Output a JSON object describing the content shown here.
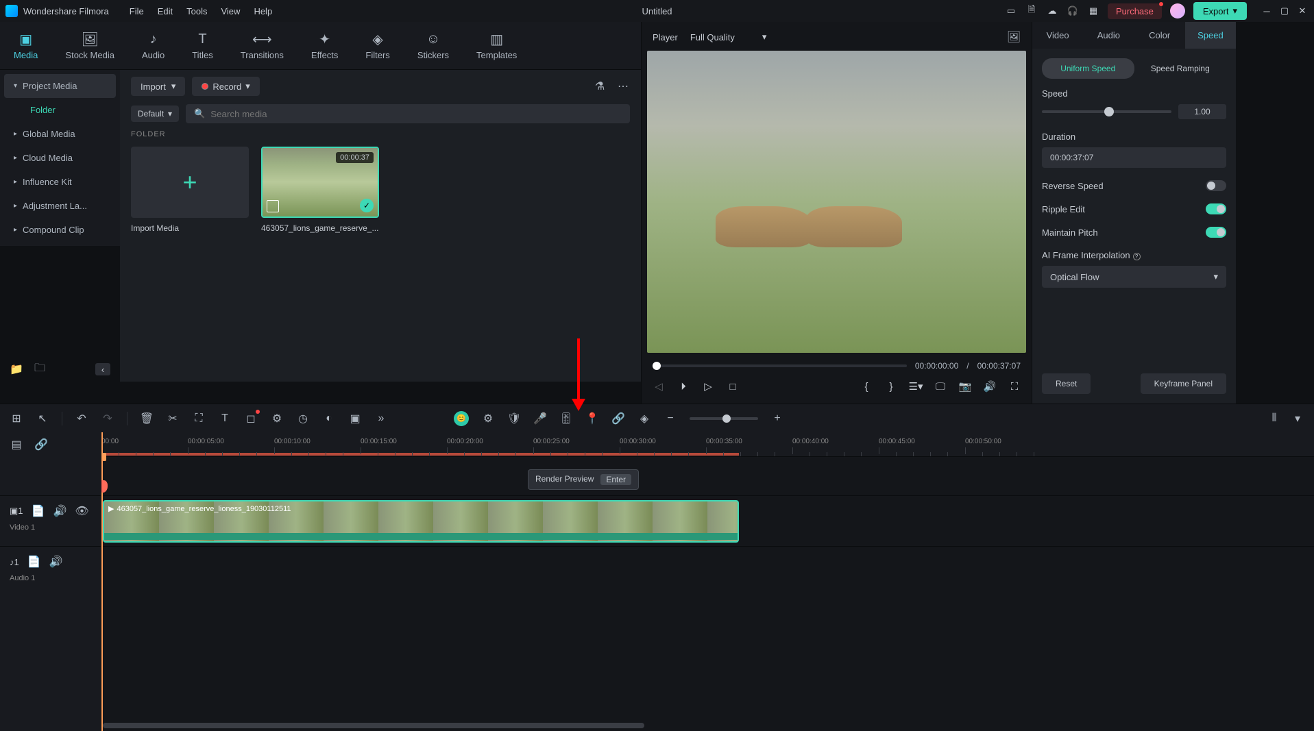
{
  "app": {
    "name": "Wondershare Filmora",
    "title": "Untitled"
  },
  "menu": {
    "file": "File",
    "edit": "Edit",
    "tools": "Tools",
    "view": "View",
    "help": "Help"
  },
  "header": {
    "purchase": "Purchase",
    "export": "Export"
  },
  "tabs": {
    "media": "Media",
    "stock": "Stock Media",
    "audio": "Audio",
    "titles": "Titles",
    "transitions": "Transitions",
    "effects": "Effects",
    "filters": "Filters",
    "stickers": "Stickers",
    "templates": "Templates"
  },
  "sidebar": {
    "project": "Project Media",
    "folder": "Folder",
    "global": "Global Media",
    "cloud": "Cloud Media",
    "influence": "Influence Kit",
    "adjustment": "Adjustment La...",
    "compound": "Compound Clip"
  },
  "media_bar": {
    "import": "Import",
    "record": "Record",
    "default": "Default",
    "search_placeholder": "Search media",
    "folder_heading": "FOLDER",
    "import_media": "Import Media",
    "clip_name": "463057_lions_game_reserve_...",
    "clip_duration": "00:00:37"
  },
  "player": {
    "label": "Player",
    "quality": "Full Quality",
    "current": "00:00:00:00",
    "sep": "/",
    "total": "00:00:37:07"
  },
  "props": {
    "tabs": {
      "video": "Video",
      "audio": "Audio",
      "color": "Color",
      "speed": "Speed"
    },
    "speed_tabs": {
      "uniform": "Uniform Speed",
      "ramping": "Speed Ramping"
    },
    "speed_label": "Speed",
    "speed_value": "1.00",
    "duration_label": "Duration",
    "duration_value": "00:00:37:07",
    "reverse": "Reverse Speed",
    "ripple": "Ripple Edit",
    "pitch": "Maintain Pitch",
    "ai_interp": "AI Frame Interpolation",
    "ai_value": "Optical Flow",
    "reset": "Reset",
    "keyframe": "Keyframe Panel"
  },
  "tooltip": {
    "text": "Render Preview",
    "key": "Enter"
  },
  "timeline": {
    "marks": [
      "00:00",
      "00:00:05:00",
      "00:00:10:00",
      "00:00:15:00",
      "00:00:20:00",
      "00:00:25:00",
      "00:00:30:00",
      "00:00:35:00",
      "00:00:40:00",
      "00:00:45:00",
      "00:00:50:00"
    ],
    "video_track": "Video 1",
    "audio_track": "Audio 1",
    "clip_name": "463057_lions_game_reserve_lioness_19030112511"
  }
}
